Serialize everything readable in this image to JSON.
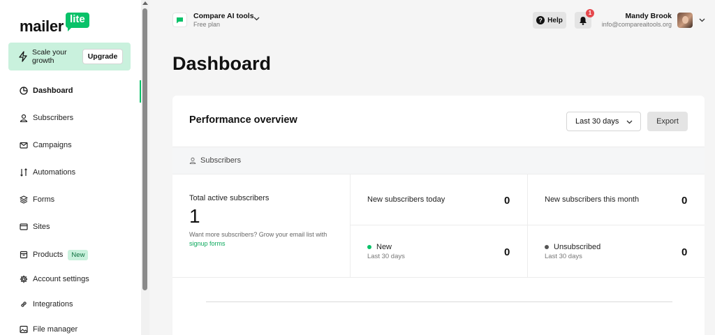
{
  "sidebar": {
    "logo_mailer": "mailer",
    "logo_lite": "lite",
    "upgrade_text": "Scale your growth",
    "upgrade_button": "Upgrade",
    "items": [
      {
        "label": "Dashboard",
        "icon": "dashboard-icon"
      },
      {
        "label": "Subscribers",
        "icon": "user-icon"
      },
      {
        "label": "Campaigns",
        "icon": "mail-icon"
      },
      {
        "label": "Automations",
        "icon": "automation-icon"
      },
      {
        "label": "Forms",
        "icon": "layers-icon"
      },
      {
        "label": "Sites",
        "icon": "browser-icon"
      },
      {
        "label": "Products",
        "icon": "package-icon",
        "badge": "New"
      },
      {
        "label": "Account settings",
        "icon": "gear-icon"
      },
      {
        "label": "Integrations",
        "icon": "link-icon"
      },
      {
        "label": "File manager",
        "icon": "image-icon"
      }
    ]
  },
  "header": {
    "account_name": "Compare AI tools",
    "account_plan": "Free plan",
    "help_label": "Help",
    "notification_count": "1",
    "user_name": "Mandy Brook",
    "user_email": "info@compareaitools.org"
  },
  "page": {
    "title": "Dashboard"
  },
  "performance": {
    "title": "Performance overview",
    "range": "Last 30 days",
    "export_label": "Export",
    "section_label": "Subscribers",
    "total_label": "Total active subscribers",
    "total_value": "1",
    "hint_text": "Want more subscribers? Grow your email list with ",
    "hint_link": "signup forms",
    "new_today_label": "New subscribers today",
    "new_today_value": "0",
    "new_month_label": "New subscribers this month",
    "new_month_value": "0",
    "new_label": "New",
    "new_sub": "Last 30 days",
    "new_value": "0",
    "unsub_label": "Unsubscribed",
    "unsub_sub": "Last 30 days",
    "unsub_value": "0"
  },
  "colors": {
    "brand_green": "#09c269",
    "upgrade_bg": "#c9f1dd",
    "link_green": "#09a85b",
    "badge_red": "#e5484d",
    "unsub_dot": "#555555"
  }
}
